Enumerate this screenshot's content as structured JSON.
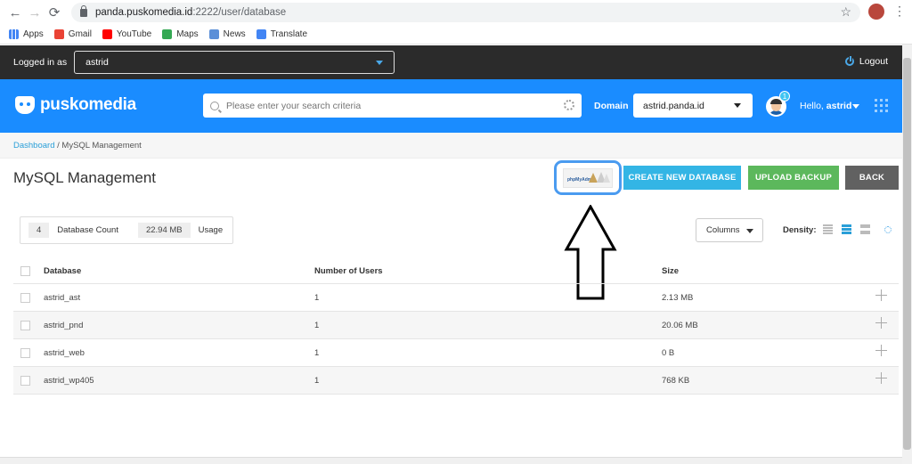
{
  "browser": {
    "back_icon": "←",
    "forward_icon": "→",
    "reload_icon": "⟳",
    "url_host": "panda.puskomedia.id",
    "url_path": ":2222/user/database",
    "bookmarks": [
      {
        "label": "Apps",
        "color": "#4285f4"
      },
      {
        "label": "Gmail",
        "color": "#ea4335"
      },
      {
        "label": "YouTube",
        "color": "#ff0000"
      },
      {
        "label": "Maps",
        "color": "#34a853"
      },
      {
        "label": "News",
        "color": "#4285f4"
      },
      {
        "label": "Translate",
        "color": "#4285f4"
      }
    ]
  },
  "topbar": {
    "logged_in_label": "Logged in as",
    "user": "astrid",
    "logout": "Logout"
  },
  "header": {
    "brand": "puskomedia",
    "search_placeholder": "Please enter your search criteria",
    "domain_label": "Domain",
    "domain_value": "astrid.panda.id",
    "notification_count": "1",
    "hello_prefix": "Hello,",
    "hello_user": "astrid"
  },
  "breadcrumb": {
    "root": "Dashboard",
    "separator": " / ",
    "current": "MySQL Management"
  },
  "page": {
    "title": "MySQL Management",
    "phpmyadmin_label": "phpMyAdmin",
    "create_button": "CREATE NEW DATABASE",
    "upload_button": "UPLOAD BACKUP",
    "back_button": "BACK"
  },
  "stats": {
    "count_value": "4",
    "count_label": "Database Count",
    "usage_value": "22.94 MB",
    "usage_label": "Usage"
  },
  "toolbar": {
    "columns_label": "Columns",
    "density_label": "Density:"
  },
  "table": {
    "headers": [
      "Database",
      "Number of Users",
      "Size"
    ],
    "rows": [
      {
        "database": "astrid_ast",
        "users": "1",
        "size": "2.13 MB"
      },
      {
        "database": "astrid_pnd",
        "users": "1",
        "size": "20.06 MB"
      },
      {
        "database": "astrid_web",
        "users": "1",
        "size": "0 B"
      },
      {
        "database": "astrid_wp405",
        "users": "1",
        "size": "768 KB"
      }
    ]
  },
  "colors": {
    "header_blue": "#1a8cff",
    "create_btn": "#33b5e5",
    "upload_btn": "#5cb85c",
    "back_btn": "#616161",
    "topbar": "#2b2b2b",
    "highlight": "#4a9bf0"
  }
}
